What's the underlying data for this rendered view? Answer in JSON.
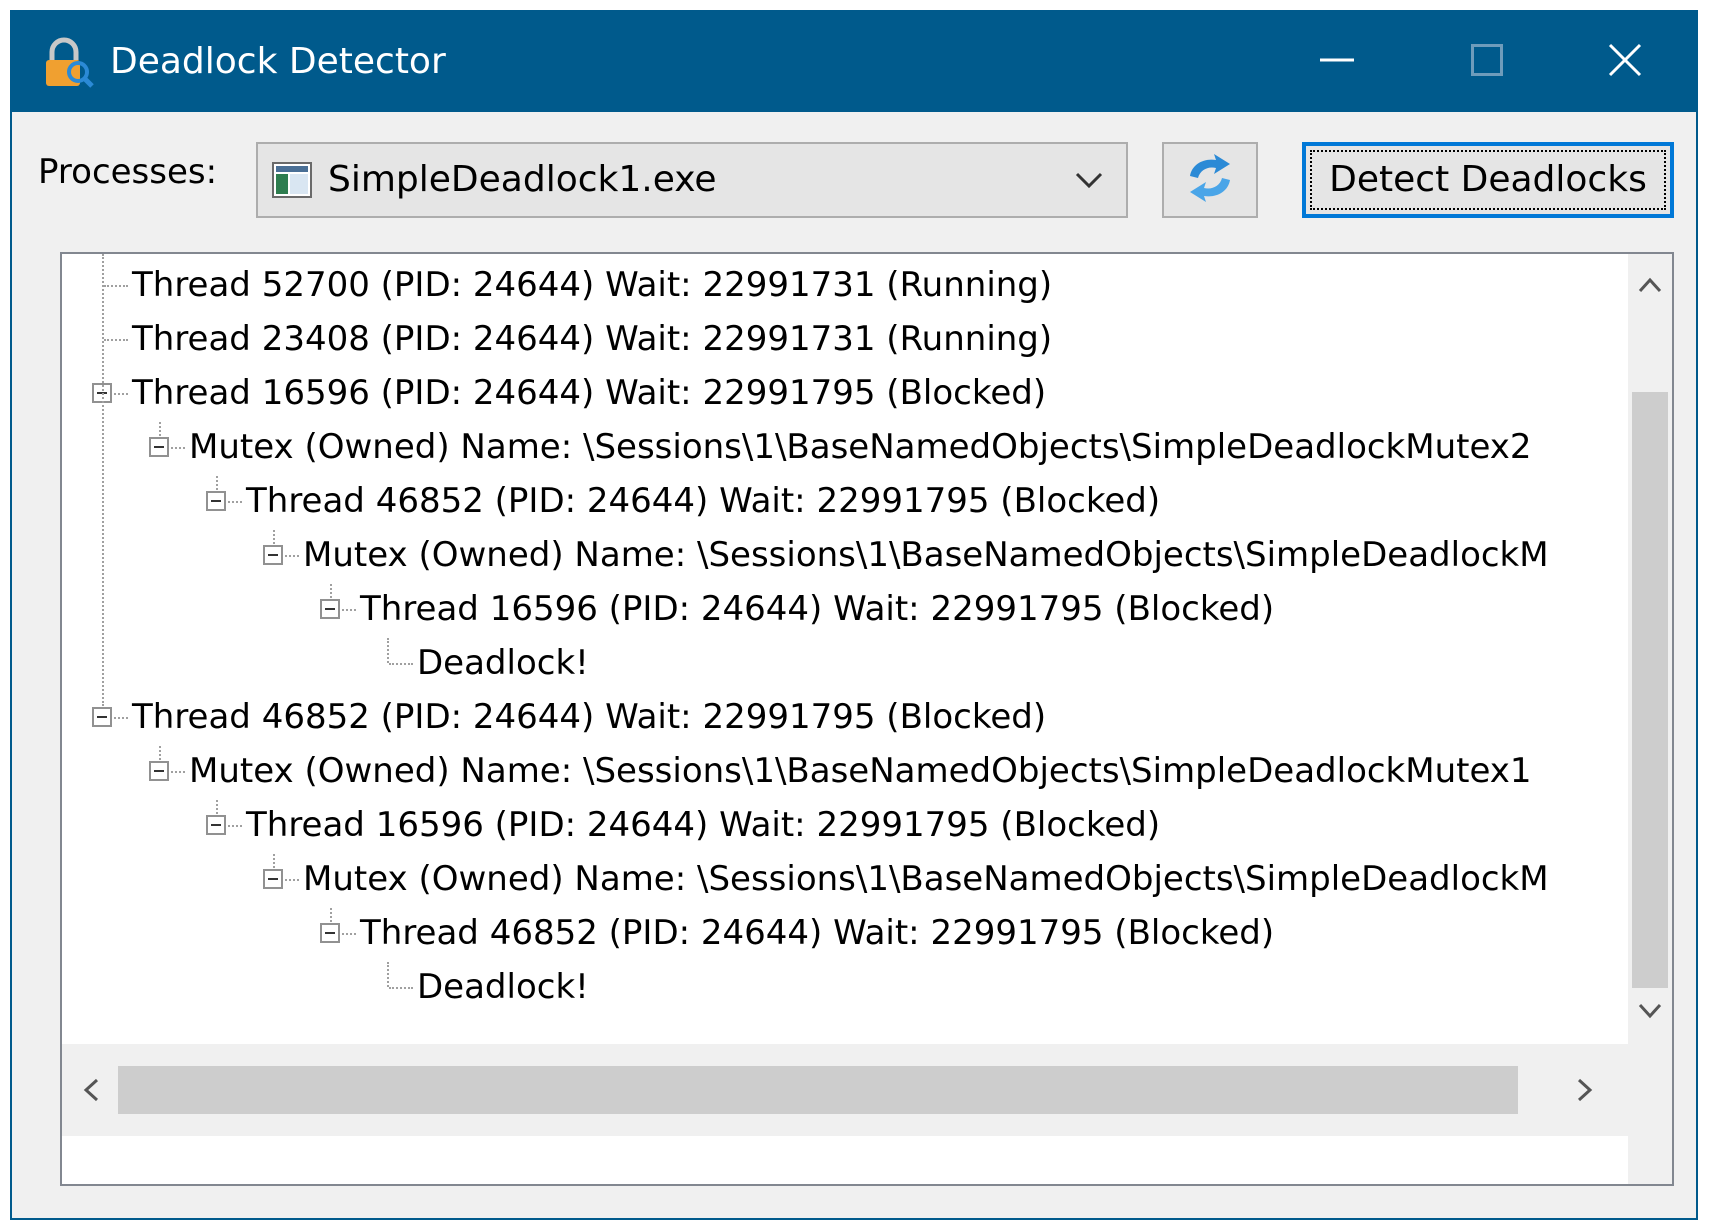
{
  "window": {
    "title": "Deadlock Detector",
    "icon": "padlock-search-icon",
    "controls": [
      "minimize-icon",
      "maximize-icon",
      "close-icon"
    ]
  },
  "toolbar": {
    "processes_label": "Processes:",
    "selected_process": "SimpleDeadlock1.exe",
    "refresh_icon": "refresh-icon",
    "detect_button_label": "Detect Deadlocks"
  },
  "tree": {
    "nodes": [
      {
        "text": "Thread 52700 (PID: 24644) Wait: 22991731 (Running)",
        "level": 0,
        "expandable": false
      },
      {
        "text": "Thread 23408 (PID: 24644) Wait: 22991731 (Running)",
        "level": 0,
        "expandable": false
      },
      {
        "text": "Thread 16596 (PID: 24644) Wait: 22991795 (Blocked)",
        "level": 0,
        "expandable": true
      },
      {
        "text": "Mutex (Owned) Name: \\Sessions\\1\\BaseNamedObjects\\SimpleDeadlockMutex2",
        "level": 1,
        "expandable": true
      },
      {
        "text": "Thread 46852 (PID: 24644) Wait: 22991795 (Blocked)",
        "level": 2,
        "expandable": true
      },
      {
        "text": "Mutex (Owned) Name: \\Sessions\\1\\BaseNamedObjects\\SimpleDeadlockM",
        "level": 3,
        "expandable": true
      },
      {
        "text": "Thread 16596 (PID: 24644) Wait: 22991795 (Blocked)",
        "level": 4,
        "expandable": true
      },
      {
        "text": "Deadlock!",
        "level": 5,
        "expandable": false
      },
      {
        "text": "Thread 46852 (PID: 24644) Wait: 22991795 (Blocked)",
        "level": 0,
        "expandable": true
      },
      {
        "text": "Mutex (Owned) Name: \\Sessions\\1\\BaseNamedObjects\\SimpleDeadlockMutex1",
        "level": 1,
        "expandable": true
      },
      {
        "text": "Thread 16596 (PID: 24644) Wait: 22991795 (Blocked)",
        "level": 2,
        "expandable": true
      },
      {
        "text": "Mutex (Owned) Name: \\Sessions\\1\\BaseNamedObjects\\SimpleDeadlockM",
        "level": 3,
        "expandable": true
      },
      {
        "text": "Thread 46852 (PID: 24644) Wait: 22991795 (Blocked)",
        "level": 4,
        "expandable": true
      },
      {
        "text": "Deadlock!",
        "level": 5,
        "expandable": false
      }
    ]
  },
  "colors": {
    "titlebar": "#005a8c",
    "focus_border": "#0078d7",
    "window_bg": "#f0f0f0"
  }
}
